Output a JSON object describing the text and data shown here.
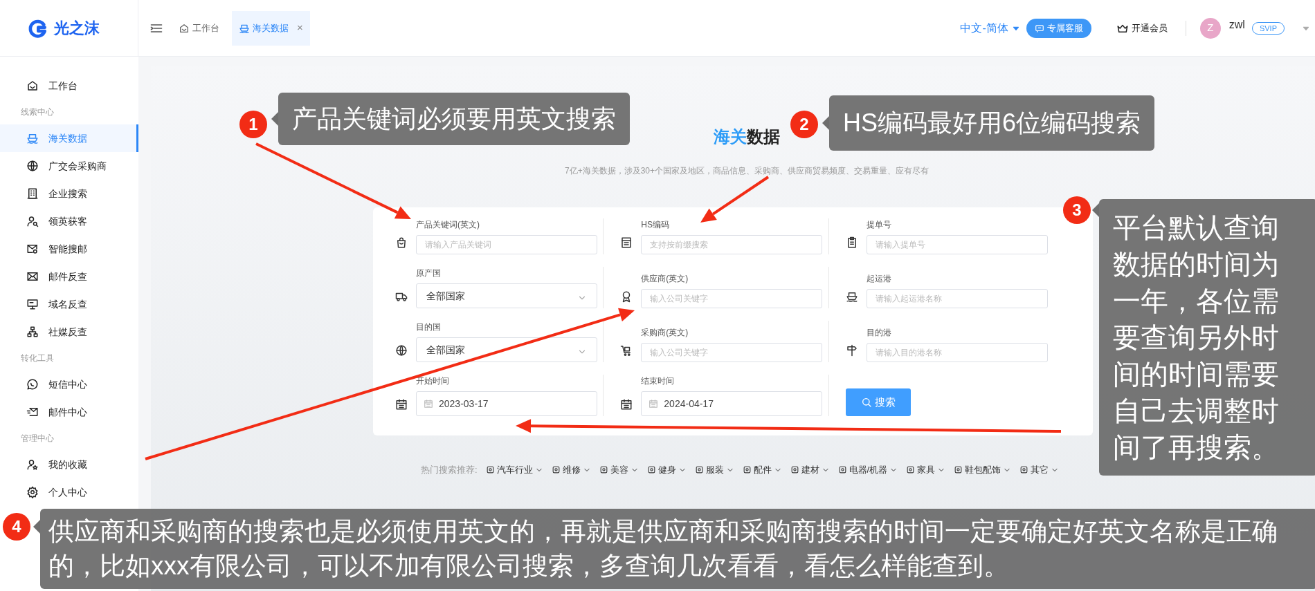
{
  "header": {
    "logo": "光之沫",
    "tabs": [
      {
        "label": "工作台",
        "selected": false,
        "closable": false
      },
      {
        "label": "海关数据",
        "selected": true,
        "closable": true
      }
    ],
    "close_mark": "×",
    "language": "中文-简体",
    "service_button": "专属客服",
    "membership": "开通会员",
    "user": {
      "avatar": "Z",
      "name": "zwl",
      "badge": "SVIP"
    }
  },
  "sidebar": {
    "groups": [
      {
        "items": [
          {
            "label": "工作台",
            "selected": false
          }
        ]
      },
      {
        "title": "线索中心",
        "items": [
          {
            "label": "海关数据",
            "selected": true
          },
          {
            "label": "广交会采购商",
            "selected": false
          },
          {
            "label": "企业搜索",
            "selected": false
          },
          {
            "label": "领英获客",
            "selected": false
          },
          {
            "label": "智能搜邮",
            "selected": false
          },
          {
            "label": "邮件反查",
            "selected": false
          },
          {
            "label": "域名反查",
            "selected": false
          },
          {
            "label": "社媒反查",
            "selected": false
          }
        ]
      },
      {
        "title": "转化工具",
        "items": [
          {
            "label": "短信中心",
            "selected": false
          },
          {
            "label": "邮件中心",
            "selected": false
          }
        ]
      },
      {
        "title": "管理中心",
        "items": [
          {
            "label": "我的收藏",
            "selected": false
          },
          {
            "label": "个人中心",
            "selected": false
          }
        ]
      }
    ]
  },
  "hero": {
    "title": [
      "海关",
      "数据"
    ],
    "subtitle": "7亿+海关数据，涉及30+个国家及地区，商品信息、采购商、供应商贸易频度、交易重量、应有尽有"
  },
  "form": {
    "fields": [
      {
        "kind": "input",
        "label": "产品关键词(英文)",
        "placeholder": "请输入产品关键词"
      },
      {
        "kind": "input",
        "label": "HS编码",
        "placeholder": "支持按前缀搜索"
      },
      {
        "kind": "input",
        "label": "提单号",
        "placeholder": "请输入提单号"
      },
      {
        "kind": "select",
        "label": "原产国",
        "value": "全部国家"
      },
      {
        "kind": "input",
        "label": "供应商(英文)",
        "placeholder": "输入公司关键字"
      },
      {
        "kind": "input",
        "label": "起运港",
        "placeholder": "请输入起运港名称"
      },
      {
        "kind": "select",
        "label": "目的国",
        "value": "全部国家"
      },
      {
        "kind": "input",
        "label": "采购商(英文)",
        "placeholder": "输入公司关键字"
      },
      {
        "kind": "input",
        "label": "目的港",
        "placeholder": "请输入目的港名称"
      },
      {
        "kind": "date",
        "label": "开始时间",
        "value": "2023-03-17"
      },
      {
        "kind": "date",
        "label": "结束时间",
        "value": "2024-04-17"
      }
    ],
    "search_button": "搜索"
  },
  "hot_search": {
    "label": "热门搜索推荐:",
    "items": [
      "汽车行业",
      "维修",
      "美容",
      "健身",
      "服装",
      "配件",
      "建材",
      "电器/机器",
      "家具",
      "鞋包配饰",
      "其它"
    ]
  },
  "callouts": [
    {
      "number": "1",
      "text": "产品关键词必须要用英文搜索"
    },
    {
      "number": "2",
      "text": "HS编码最好用6位编码搜索"
    },
    {
      "number": "3",
      "text": "平台默认查询数据的时间为一年，各位需要查询另外时间的时间需要自己去调整时间了再搜索。"
    },
    {
      "number": "4",
      "text": "供应商和采购商的搜索也是必须使用英文的，再就是供应商和采购商搜索的时间一定要确定好英文名称是正确的，比如xxx有限公司，可以不加有限公司搜索，多查询几次看看，看怎么样能查到。"
    }
  ]
}
